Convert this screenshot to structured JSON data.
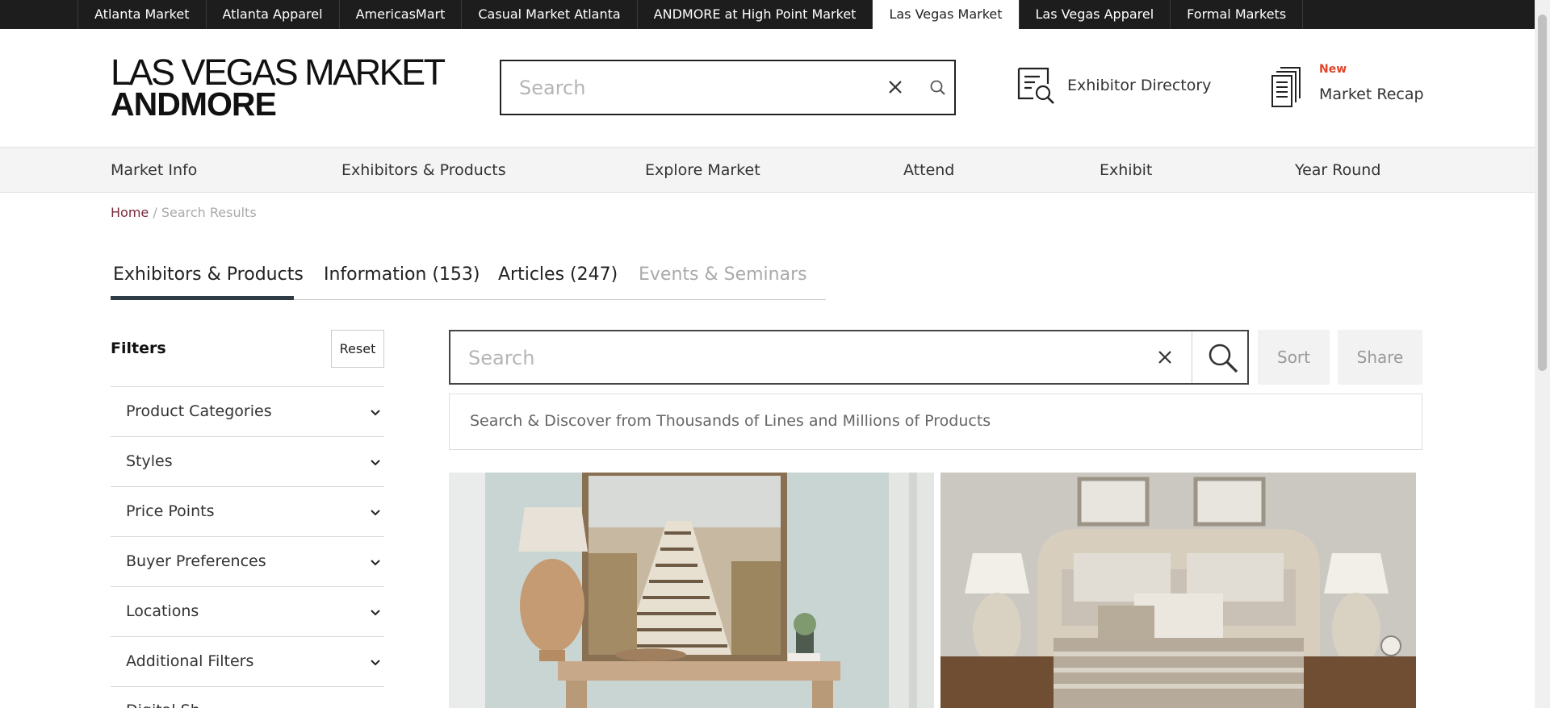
{
  "market_tabs": [
    {
      "label": "Atlanta Market"
    },
    {
      "label": "Atlanta Apparel"
    },
    {
      "label": "AmericasMart"
    },
    {
      "label": "Casual Market Atlanta"
    },
    {
      "label": "ANDMORE at High Point Market"
    },
    {
      "label": "Las Vegas Market",
      "active": true
    },
    {
      "label": "Las Vegas Apparel"
    },
    {
      "label": "Formal Markets"
    }
  ],
  "logo": {
    "line1": "LAS VEGAS MARKET",
    "line2": "ANDMORE"
  },
  "header": {
    "search_placeholder": "Search",
    "exhibitor_directory": "Exhibitor Directory",
    "market_recap": {
      "badge": "New",
      "label": "Market Recap"
    }
  },
  "main_nav": [
    "Market Info",
    "Exhibitors & Products",
    "Explore Market",
    "Attend",
    "Exhibit",
    "Year Round"
  ],
  "breadcrumb": {
    "home": "Home",
    "separator": "/",
    "current": "Search Results"
  },
  "result_tabs": [
    {
      "label": "Exhibitors & Products",
      "active": true
    },
    {
      "label": "Information (153)"
    },
    {
      "label": "Articles (247)"
    },
    {
      "label": "Events & Seminars",
      "disabled": true
    }
  ],
  "filters": {
    "title": "Filters",
    "reset_label": "Reset",
    "items": [
      "Product Categories",
      "Styles",
      "Price Points",
      "Buyer Preferences",
      "Locations",
      "Additional Filters",
      "Digital Sh"
    ]
  },
  "product_search": {
    "placeholder": "Search",
    "sort_label": "Sort",
    "share_label": "Share",
    "discover_text": "Search & Discover from Thousands of Lines and Millions of Products"
  },
  "colors": {
    "accent_tab_underline": "#2f3b44",
    "breadcrumb_link": "#7a2a3c",
    "new_badge": "#e0462b"
  },
  "icons": [
    "close-icon",
    "search-icon",
    "directory-search-icon",
    "document-stack-icon",
    "chevron-down-icon"
  ]
}
